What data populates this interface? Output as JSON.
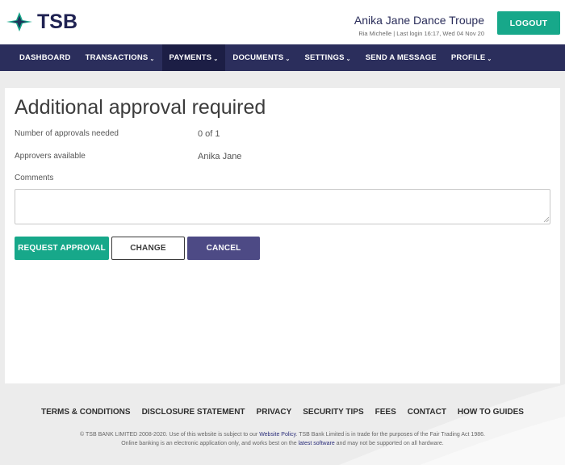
{
  "header": {
    "logo_text": "TSB",
    "account_name": "Anika Jane Dance Troupe",
    "account_meta": "Ria Michelle | Last login 16:17, Wed 04 Nov 20",
    "logout_label": "LOGOUT"
  },
  "nav": {
    "items": [
      {
        "label": "DASHBOARD",
        "caret": ""
      },
      {
        "label": "TRANSACTIONS",
        "caret": "⌄"
      },
      {
        "label": "PAYMENTS",
        "caret": "⌄"
      },
      {
        "label": "DOCUMENTS",
        "caret": "⌄"
      },
      {
        "label": "SETTINGS",
        "caret": "⌄"
      },
      {
        "label": "SEND A MESSAGE",
        "caret": ""
      },
      {
        "label": "PROFILE",
        "caret": "⌄"
      }
    ],
    "active": "PAYMENTS"
  },
  "approval": {
    "title": "Additional approval required",
    "approvals_needed_label": "Number of approvals needed",
    "approvals_needed_value": "0 of 1",
    "approvers_label": "Approvers available",
    "approvers_value": "Anika Jane",
    "comments_label": "Comments",
    "comments_value": ""
  },
  "actions": {
    "request_label": "REQUEST APPROVAL",
    "change_label": "CHANGE",
    "cancel_label": "CANCEL"
  },
  "footer": {
    "links": [
      "TERMS & CONDITIONS",
      "DISCLOSURE STATEMENT",
      "PRIVACY",
      "SECURITY TIPS",
      "FEES",
      "CONTACT",
      "HOW TO GUIDES"
    ],
    "legal_1a": "© TSB BANK LIMITED 2008-2020. Use of this website is subject to our ",
    "legal_1_link": "Website Policy",
    "legal_1b": ". TSB Bank Limited is in trade for the purposes of the Fair Trading Act 1986.",
    "legal_2a": "Online banking is an electronic application only, and works best on the ",
    "legal_2_link": "latest software",
    "legal_2b": " and may not be supported on all hardware."
  },
  "colors": {
    "brand_navy": "#2b2e5c",
    "brand_teal": "#17a88a",
    "cancel_purple": "#4d4a85"
  }
}
